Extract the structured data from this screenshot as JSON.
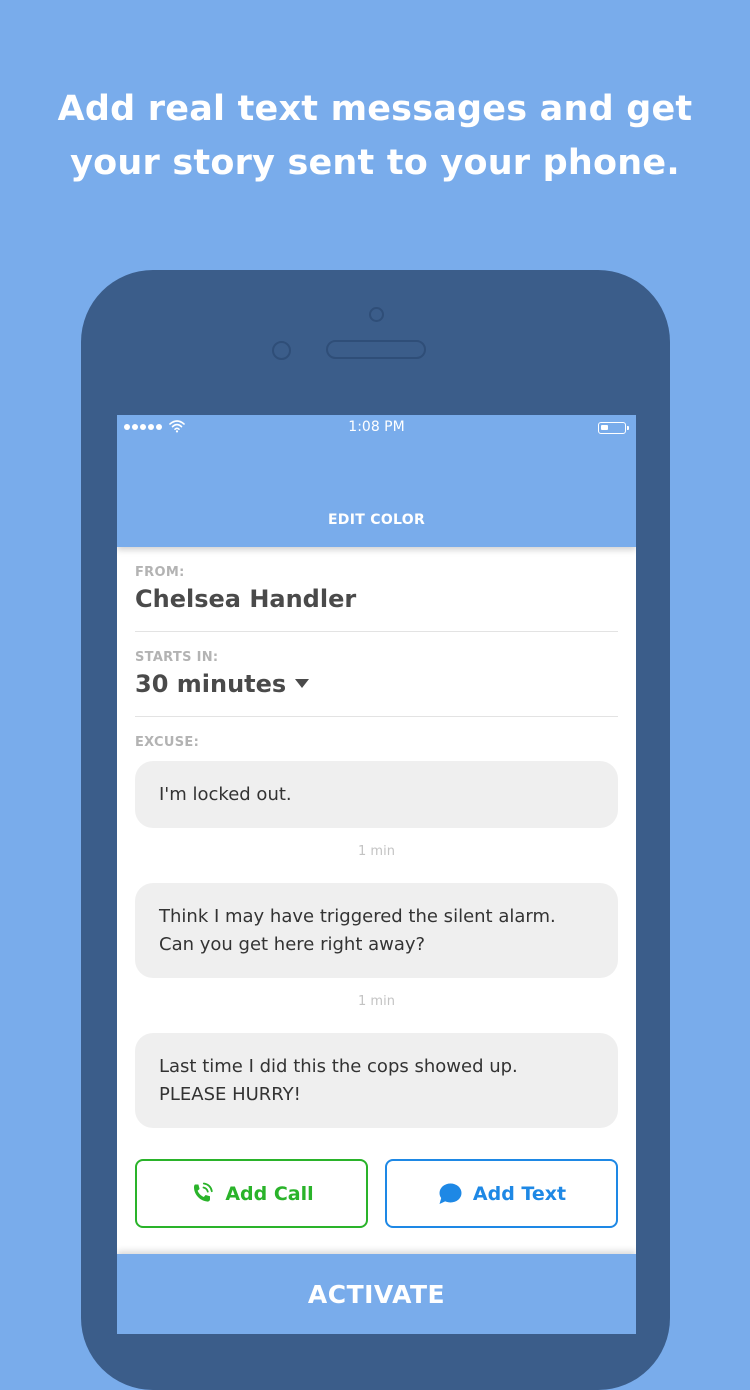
{
  "headline": {
    "line1": "Add real text messages and get",
    "line2": "your story sent to your phone."
  },
  "status_bar": {
    "time": "1:08 PM"
  },
  "header": {
    "edit_color": "EDIT COLOR"
  },
  "form": {
    "from": {
      "label": "FROM:",
      "value": "Chelsea Handler"
    },
    "starts_in": {
      "label": "STARTS IN:",
      "value": "30 minutes"
    },
    "excuse": {
      "label": "EXCUSE:"
    }
  },
  "messages": [
    {
      "lines": [
        "I'm locked out."
      ]
    },
    {
      "timestamp": "1 min",
      "lines": [
        "Think I may have triggered the silent alarm.",
        "Can you get here right away?"
      ]
    },
    {
      "timestamp": "1 min",
      "lines": [
        "Last time I did this the cops showed up.",
        "PLEASE HURRY!"
      ]
    }
  ],
  "actions": {
    "add_call": "Add Call",
    "add_text": "Add Text",
    "activate": "ACTIVATE"
  },
  "colors": {
    "background": "#79aceb",
    "phone_body": "#3b5d8a",
    "call_green": "#2ab32a",
    "text_blue": "#1e88e5"
  },
  "icons": {
    "call": "phone-call-icon",
    "text": "chat-bubble-icon",
    "wifi": "wifi-icon",
    "battery": "battery-icon",
    "caret": "caret-down-icon"
  }
}
